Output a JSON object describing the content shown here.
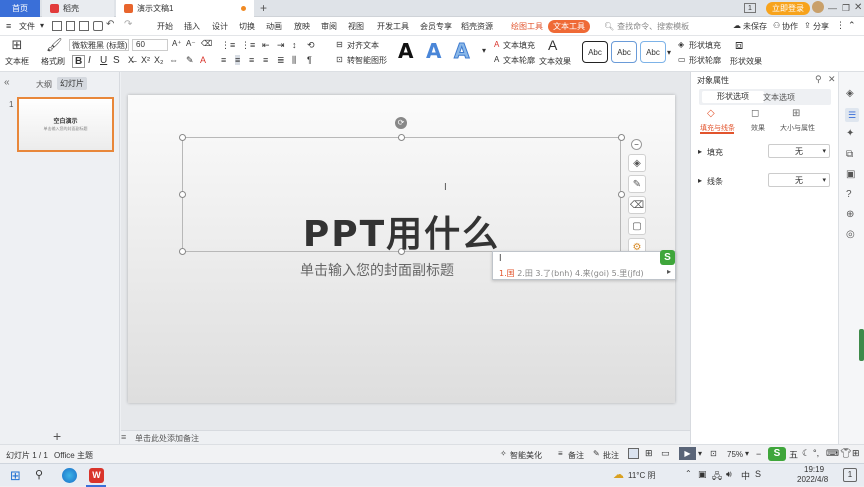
{
  "tabs": {
    "home": "首页",
    "daoke": "稻壳",
    "doc": "演示文稿1",
    "new_tab": "+"
  },
  "window": {
    "login": "立即登录"
  },
  "menubar": {
    "file": "文件",
    "items": [
      "开始",
      "插入",
      "设计",
      "切换",
      "动画",
      "放映",
      "审阅",
      "视图",
      "开发工具",
      "会员专享",
      "稻壳资源"
    ],
    "drawing_tools": "绘图工具",
    "text_tools": "文本工具",
    "search_placeholder": "查找命令、搜索模板",
    "unsaved": "未保存",
    "collab": "协作",
    "share": "分享"
  },
  "ribbon": {
    "textbox": "文本框",
    "format_painter": "格式刷",
    "font_name": "微软雅黑 (标题)",
    "font_size": "60",
    "align_text": "对齐文本",
    "smartart": "转智能图形",
    "text_fill": "文本填充",
    "text_outline": "文本轮廓",
    "text_effect": "文本效果",
    "shape_styles": [
      "Abc",
      "Abc",
      "Abc"
    ],
    "shape_fill": "形状填充",
    "shape_outline": "形状轮廓",
    "shape_effect": "形状效果"
  },
  "left_panel": {
    "outline_tab": "大纲",
    "slides_tab": "幻灯片",
    "slide_number": "1",
    "thumb_title": "空白演示",
    "thumb_sub": "单击输入您的封面副标题"
  },
  "slide": {
    "title": "PPT用什么",
    "subtitle": "单击输入您的封面副标题"
  },
  "ime": {
    "input": "l",
    "candidates": [
      "1.国",
      "2.田",
      "3.了(bnh)",
      "4.来(goi)",
      "5.里(jfd)"
    ]
  },
  "notes": {
    "placeholder": "单击此处添加备注"
  },
  "right_panel": {
    "title": "对象属性",
    "tab_shape": "形状选项",
    "tab_text": "文本选项",
    "sub_fill_line": "填充与线条",
    "sub_effect": "效果",
    "sub_size": "大小与属性",
    "fill_label": "填充",
    "fill_value": "无",
    "line_label": "线条",
    "line_value": "无"
  },
  "statusbar": {
    "slide_info": "幻灯片 1 / 1",
    "theme": "Office 主题",
    "beautify": "智能美化",
    "notes": "备注",
    "comments": "批注",
    "zoom": "75%"
  },
  "taskbar": {
    "weather": "11°C 阴",
    "time": "19:19",
    "date": "2022/4/8",
    "ime_lang": "五"
  },
  "colors": {
    "accent_orange": "#ef6a36",
    "home_tab_blue": "#3a6fd8",
    "login_orange": "#f7a31c"
  }
}
